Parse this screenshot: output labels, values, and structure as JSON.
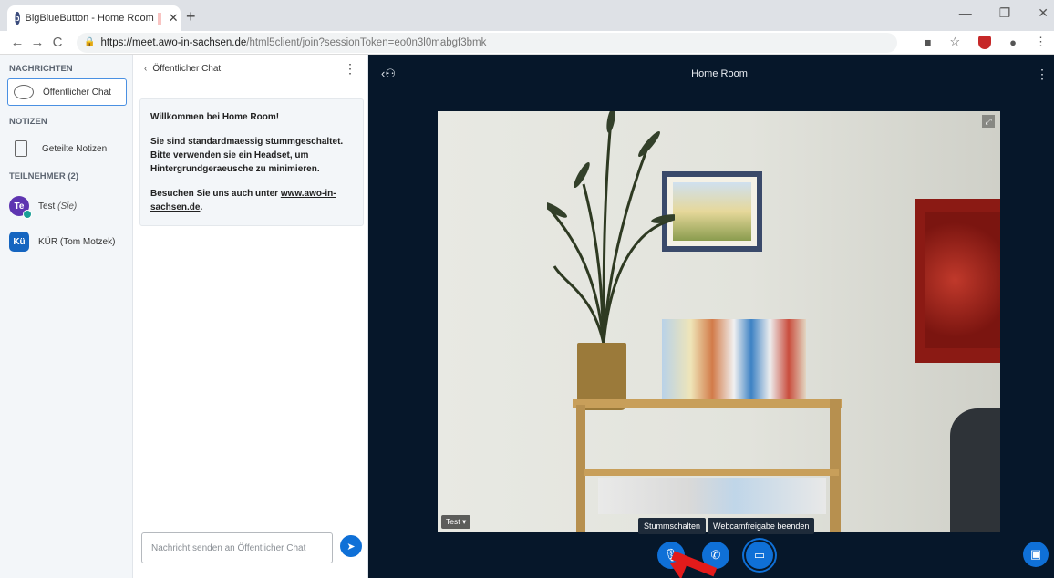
{
  "browser": {
    "tab_title": "BigBlueButton - Home Room",
    "tab_favicon": "bigbluebutton-icon",
    "url_host": "https://meet.awo-in-sachsen.de",
    "url_path": "/html5client/join?sessionToken=eo0n3l0mabgf3bmk"
  },
  "userlist": {
    "messages_title": "NACHRICHTEN",
    "public_chat_label": "Öffentlicher Chat",
    "notes_title": "NOTIZEN",
    "shared_notes_label": "Geteilte Notizen",
    "participants_title": "TEILNEHMER (2)",
    "users": [
      {
        "initials": "Te",
        "name": "Test",
        "suffix": "(Sie)"
      },
      {
        "initials": "Kü",
        "name": "KÜR (Tom Motzek)",
        "suffix": ""
      }
    ]
  },
  "chat": {
    "header_title": "Öffentlicher Chat",
    "welcome_prefix": "Willkommen bei ",
    "welcome_room": "Home Room",
    "welcome_suffix": "!",
    "welcome_line2": "Sie sind standardmaessig stummgeschaltet. Bitte verwenden sie ein Headset, um Hintergrundgeraeusche zu minimieren.",
    "welcome_visit_prefix": "Besuchen Sie uns auch unter ",
    "welcome_link": "www.awo-in-sachsen.de",
    "welcome_visit_suffix": ".",
    "input_placeholder": "Nachricht senden an Öffentlicher Chat"
  },
  "presentation": {
    "room_title": "Home Room",
    "camera_user_label": "Test",
    "tooltip_mute": "Stummschalten",
    "tooltip_webcam": "Webcamfreigabe beenden"
  },
  "colors": {
    "accent": "#0f70d7",
    "presentation_bg": "#06172a",
    "arrow": "#e31b1b"
  }
}
